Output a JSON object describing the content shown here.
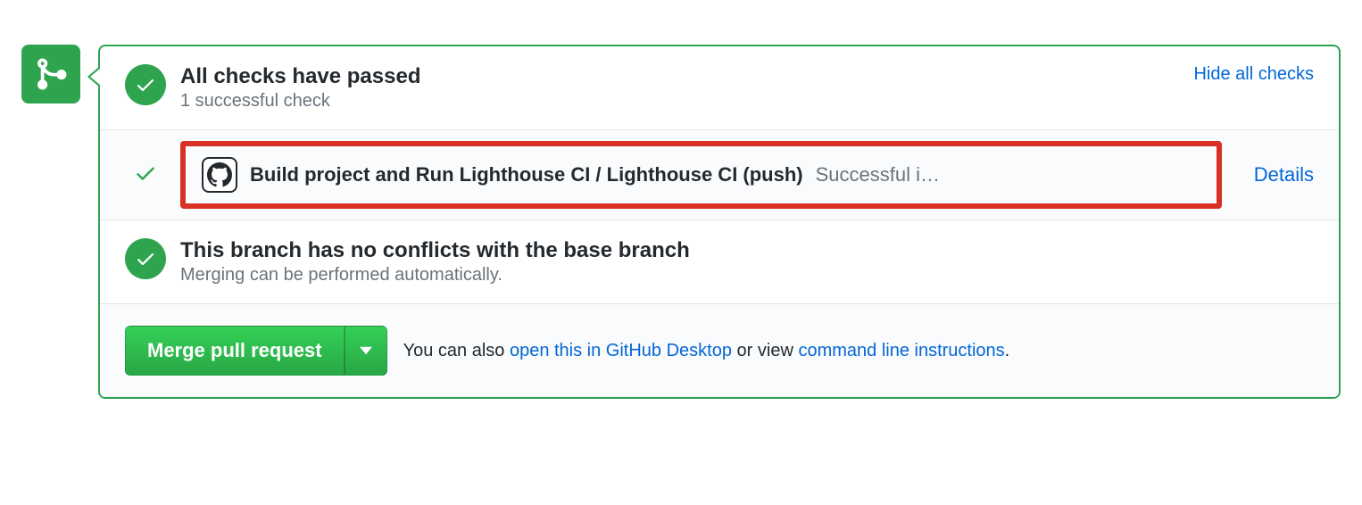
{
  "checks": {
    "title": "All checks have passed",
    "subtitle": "1 successful check",
    "toggle_label": "Hide all checks",
    "items": [
      {
        "name": "Build project and Run Lighthouse CI / Lighthouse CI (push)",
        "status_text": "Successful i…",
        "details_label": "Details"
      }
    ]
  },
  "conflicts": {
    "title": "This branch has no conflicts with the base branch",
    "subtitle": "Merging can be performed automatically."
  },
  "footer": {
    "merge_button_label": "Merge pull request",
    "prefix_text": "You can also ",
    "desktop_link": "open this in GitHub Desktop",
    "middle_text": " or view ",
    "cli_link": "command line instructions",
    "suffix_text": "."
  }
}
